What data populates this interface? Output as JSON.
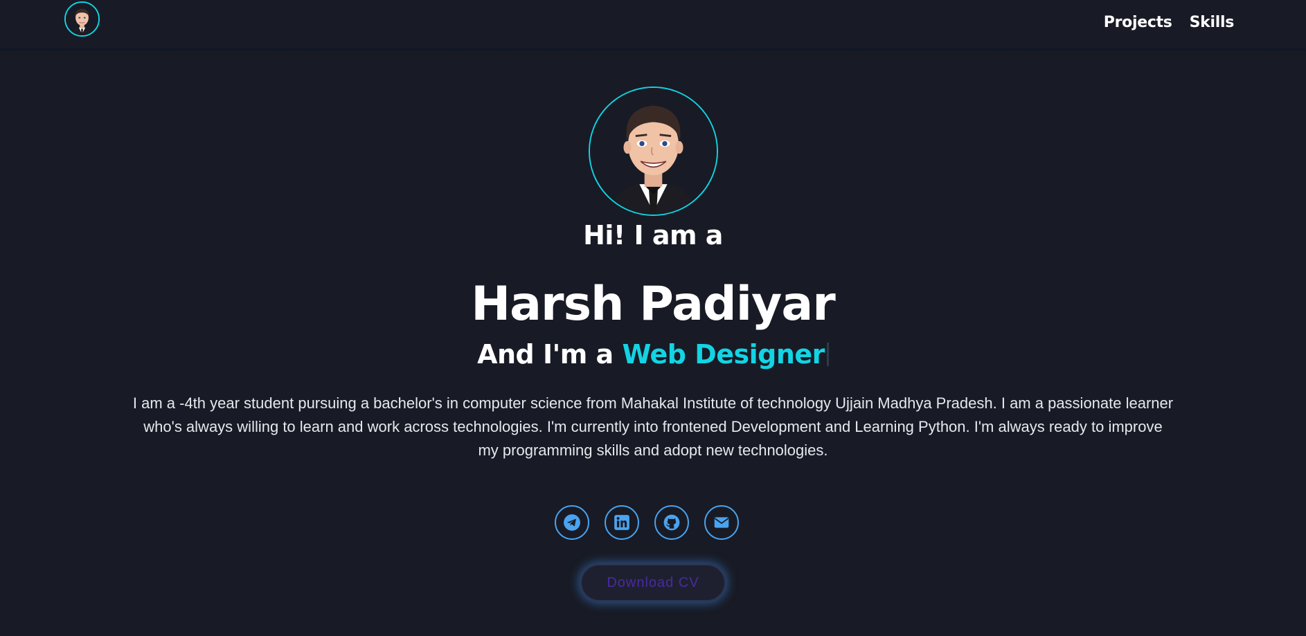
{
  "nav": {
    "avatar_icon": "avatar-icon",
    "links": [
      "Projects",
      "Skills"
    ]
  },
  "hero": {
    "greeting": "Hi! I am a",
    "name": "Harsh Padiyar",
    "role_prefix": "And I'm a ",
    "role_accent": "Web Designer",
    "bio": "I am a -4th year student pursuing a bachelor's in computer science from Mahakal Institute of technology Ujjain Madhya Pradesh. I am a passionate learner who's always willing to learn and work across technologies. I'm currently into frontened Development and Learning Python. I'm always ready to improve my programming skills and adopt new technologies."
  },
  "socials": [
    {
      "icon": "telegram-icon"
    },
    {
      "icon": "linkedin-icon"
    },
    {
      "icon": "github-icon"
    },
    {
      "icon": "envelope-icon"
    }
  ],
  "cv_button": {
    "label": "Download CV"
  },
  "colors": {
    "background": "#181b25",
    "accent": "#12d4e4",
    "social": "#4aa3f0",
    "cv_text": "#4a2aa0"
  }
}
